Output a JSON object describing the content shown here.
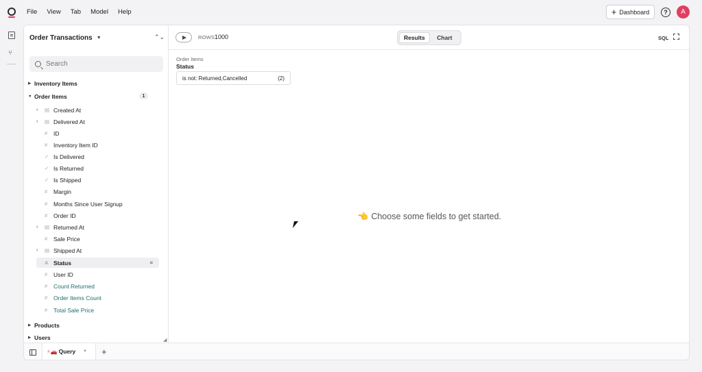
{
  "menu": [
    "File",
    "View",
    "Tab",
    "Model",
    "Help"
  ],
  "header": {
    "dashboard_label": "Dashboard",
    "help_glyph": "?",
    "avatar_initial": "A"
  },
  "explore": {
    "title": "Order Transactions"
  },
  "search": {
    "placeholder": "Search"
  },
  "views": {
    "inventory_items": {
      "label": "Inventory Items"
    },
    "order_items": {
      "label": "Order Items",
      "badge": "1"
    },
    "products": {
      "label": "Products"
    },
    "users": {
      "label": "Users"
    }
  },
  "fields": [
    {
      "label": "Created At",
      "type": "time",
      "expandable": true
    },
    {
      "label": "Delivered At",
      "type": "time",
      "expandable": true
    },
    {
      "label": "ID",
      "type": "number"
    },
    {
      "label": "Inventory Item ID",
      "type": "number"
    },
    {
      "label": "Is Delivered",
      "type": "boolean"
    },
    {
      "label": "Is Returned",
      "type": "boolean"
    },
    {
      "label": "Is Shipped",
      "type": "boolean"
    },
    {
      "label": "Margin",
      "type": "number"
    },
    {
      "label": "Months Since User Signup",
      "type": "number"
    },
    {
      "label": "Order ID",
      "type": "number"
    },
    {
      "label": "Returned At",
      "type": "time",
      "expandable": true
    },
    {
      "label": "Sale Price",
      "type": "number"
    },
    {
      "label": "Shipped At",
      "type": "time",
      "expandable": true
    },
    {
      "label": "Status",
      "type": "string",
      "selected": true
    },
    {
      "label": "User ID",
      "type": "number"
    },
    {
      "label": "Count Returned",
      "type": "number",
      "measure": true
    },
    {
      "label": "Order Items Count",
      "type": "number",
      "measure": true
    },
    {
      "label": "Total Sale Price",
      "type": "number",
      "measure": true
    }
  ],
  "toolbar": {
    "rows_label": "ROWS",
    "rows_value": "1000",
    "tabs": [
      "Results",
      "Chart"
    ],
    "active_tab": "Results",
    "sql_label": "SQL"
  },
  "filter": {
    "view": "Order Items",
    "field": "Status",
    "expression": "is not: Returned,Cancelled",
    "count": "(2)"
  },
  "empty_state": {
    "icon": "👈",
    "text": "Choose some fields to get started."
  },
  "bottom": {
    "query_tab_label": "Query",
    "query_tab_icon": "⚡🚗"
  },
  "colors": {
    "accent": "#e03e63",
    "measure": "#1f6e6a"
  }
}
